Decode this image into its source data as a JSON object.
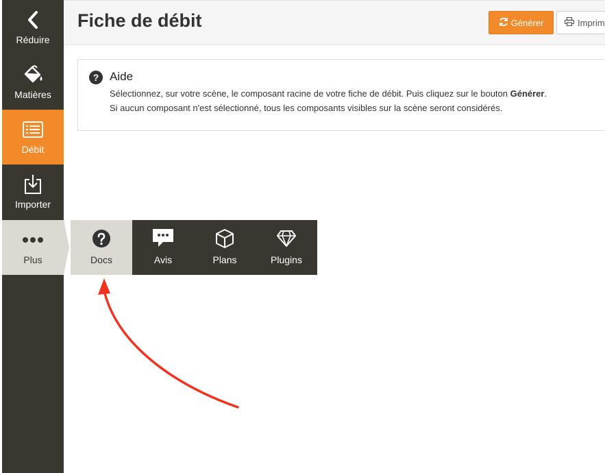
{
  "sidebar": {
    "items": [
      {
        "label": "Réduire",
        "icon": "chevron-left-icon"
      },
      {
        "label": "Matières",
        "icon": "paint-bucket-icon"
      },
      {
        "label": "Débit",
        "icon": "list-icon",
        "active": true
      },
      {
        "label": "Importer",
        "icon": "import-icon"
      },
      {
        "label": "Plus",
        "icon": "more-dots-icon"
      }
    ]
  },
  "header": {
    "title": "Fiche de débit",
    "generate_label": "Générer",
    "print_label": "Imprimer"
  },
  "help": {
    "title": "Aide",
    "line1_prefix": "Sélectionnez, sur votre scène, le composant racine de votre fiche de débit. Puis cliquez sur le bouton ",
    "line1_bold": "Générer",
    "line1_suffix": ".",
    "line2": "Si aucun composant n'est sélectionné, tous les composants visibles sur la scène seront considérés."
  },
  "flyout": {
    "items": [
      {
        "label": "Docs",
        "icon": "question-circle-icon",
        "highlighted": true
      },
      {
        "label": "Avis",
        "icon": "review-bubble-icon"
      },
      {
        "label": "Plans",
        "icon": "cube-icon"
      },
      {
        "label": "Plugins",
        "icon": "diamond-icon"
      }
    ]
  },
  "colors": {
    "sidebar_bg": "#3a3630",
    "accent": "#f28a2a",
    "highlight": "#dcd9d3",
    "annotation_arrow": "#f0321e"
  }
}
